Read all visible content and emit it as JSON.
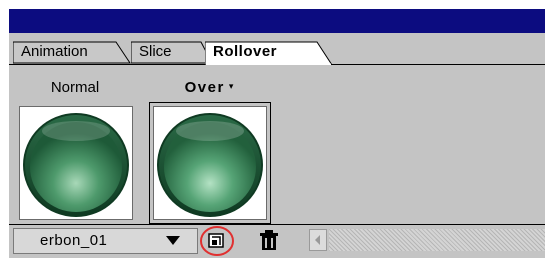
{
  "tabs": [
    {
      "label": "Animation",
      "active": false
    },
    {
      "label": "Slice",
      "active": false
    },
    {
      "label": "Rollover",
      "active": true
    }
  ],
  "states": [
    {
      "label": "Normal",
      "selected": false,
      "thumbnail_icon": "green-button-icon"
    },
    {
      "label": "Over",
      "selected": true,
      "has_dropdown": true,
      "thumbnail_icon": "green-button-icon"
    }
  ],
  "bottombar": {
    "layer_name": "erbon_01",
    "new_state_icon": "new-state-icon",
    "delete_icon": "trash-icon",
    "highlight_color": "#e03030"
  },
  "colors": {
    "titlebar": "#0c0c80",
    "panel": "#c4c4c4",
    "button_green": "#3f8a5f"
  }
}
